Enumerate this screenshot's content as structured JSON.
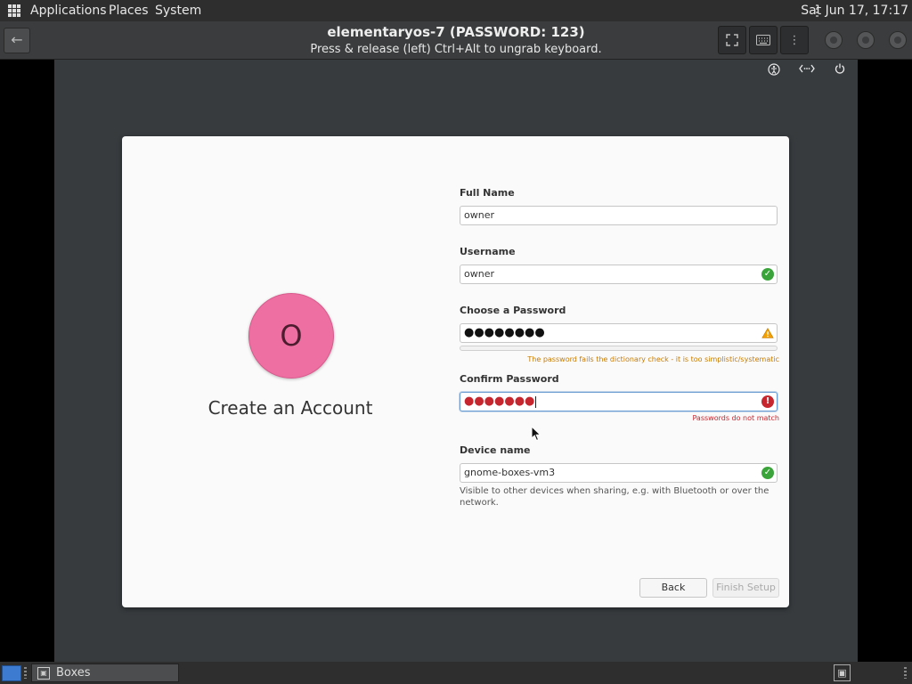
{
  "topbar": {
    "menus": [
      "Applications",
      "Places",
      "System"
    ],
    "clock": "Sat Jun 17, 17:17"
  },
  "header": {
    "title": "elementaryos-7 (PASSWORD: 123)",
    "subtitle": "Press & release (left) Ctrl+Alt to ungrab keyboard."
  },
  "form": {
    "heading": "Create an Account",
    "avatar_letter": "O",
    "full_name_label": "Full Name",
    "full_name_value": "owner",
    "username_label": "Username",
    "username_value": "owner",
    "password_label": "Choose a Password",
    "password_value": "●●●●●●●●",
    "password_warning": "The password fails the dictionary check - it is too simplistic/systematic",
    "confirm_label": "Confirm Password",
    "confirm_value": "●●●●●●●",
    "confirm_error": "Passwords do not match",
    "device_label": "Device name",
    "device_value": "gnome-boxes-vm3",
    "device_description": "Visible to other devices when sharing, e.g. with Bluetooth or over the network.",
    "back_label": "Back",
    "finish_label": "Finish Setup"
  },
  "taskbar": {
    "task_label": "Boxes"
  },
  "colors": {
    "avatar": "#ee6fa2",
    "ok": "#3aa43a",
    "error": "#c6262e",
    "warning": "#f4a100"
  }
}
